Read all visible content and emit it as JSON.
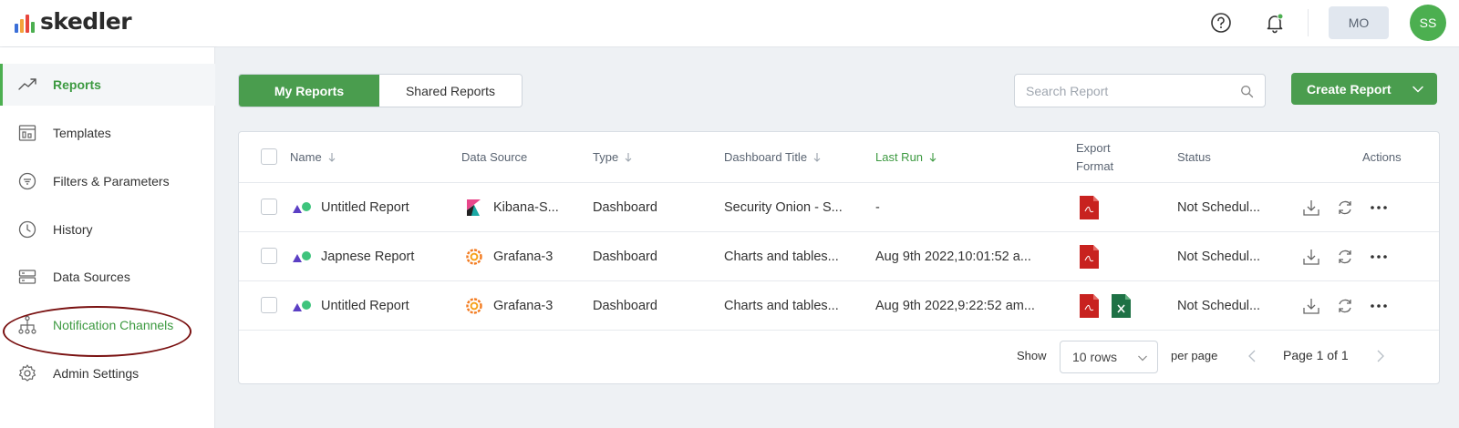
{
  "app": {
    "logo_text": "skedler",
    "logo_bar_colors": [
      "#3b6fd8",
      "#f3a33a",
      "#e8453c",
      "#4caf50"
    ],
    "accent_color": "#4a9d4e"
  },
  "header": {
    "help_icon": "help-circle-icon",
    "bell_icon": "bell-icon",
    "mo_label": "MO",
    "avatar_initials": "SS"
  },
  "sidebar": {
    "items": [
      {
        "label": "Reports",
        "icon": "trending-up-icon"
      },
      {
        "label": "Templates",
        "icon": "template-icon"
      },
      {
        "label": "Filters & Parameters",
        "icon": "filter-icon"
      },
      {
        "label": "History",
        "icon": "clock-icon"
      },
      {
        "label": "Data Sources",
        "icon": "server-icon"
      },
      {
        "label": "Notification Channels",
        "icon": "hierarchy-icon"
      },
      {
        "label": "Admin Settings",
        "icon": "gear-icon"
      }
    ]
  },
  "main": {
    "tabs": [
      {
        "label": "My Reports"
      },
      {
        "label": "Shared Reports"
      }
    ],
    "search": {
      "placeholder": "Search Report"
    },
    "create_button": "Create Report",
    "table": {
      "headers": {
        "name": "Name",
        "data_source": "Data Source",
        "type": "Type",
        "dashboard_title": "Dashboard Title",
        "last_run": "Last Run",
        "export_format": "Export Format",
        "status": "Status",
        "actions": "Actions"
      },
      "rows": [
        {
          "name": "Untitled Report",
          "data_source": "Kibana-S...",
          "source_icon": "kibana-icon",
          "type": "Dashboard",
          "dashboard_title": "Security Onion - S...",
          "last_run": "-",
          "formats": [
            "pdf"
          ],
          "status": "Not Schedul..."
        },
        {
          "name": "Japnese Report",
          "data_source": "Grafana-3",
          "source_icon": "grafana-icon",
          "type": "Dashboard",
          "dashboard_title": "Charts and tables...",
          "last_run": "Aug 9th 2022,10:01:52 a...",
          "formats": [
            "pdf"
          ],
          "status": "Not Schedul..."
        },
        {
          "name": "Untitled Report",
          "data_source": "Grafana-3",
          "source_icon": "grafana-icon",
          "type": "Dashboard",
          "dashboard_title": "Charts and tables...",
          "last_run": "Aug 9th 2022,9:22:52 am...",
          "formats": [
            "pdf",
            "xls"
          ],
          "status": "Not Schedul..."
        }
      ]
    },
    "footer": {
      "show_label": "Show",
      "rows_value": "10 rows",
      "per_page_label": "per page",
      "page_label": "Page 1 of 1"
    }
  }
}
